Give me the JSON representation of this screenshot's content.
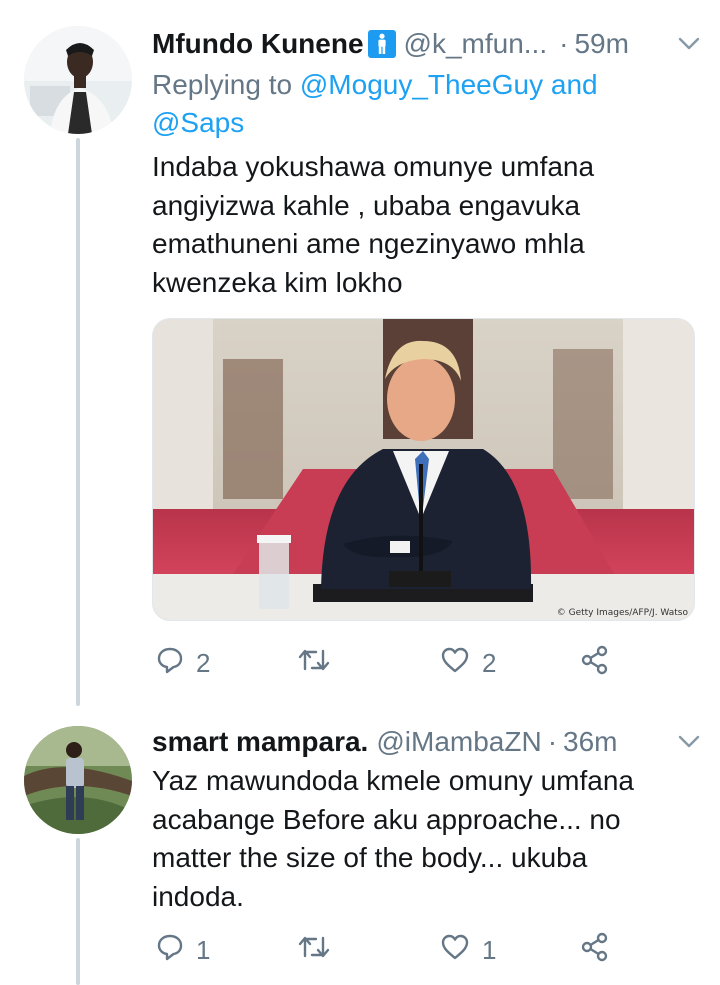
{
  "tweets": [
    {
      "display_name": "Mfundo Kunene",
      "handle": "@k_mfun...",
      "separator": "·",
      "time": "59m",
      "replying_label": "Replying to",
      "reply_mentions": [
        "@Moguy_TheeGuy",
        "@Saps"
      ],
      "reply_joiner": "and",
      "text_lines": [
        "Indaba yokushawa omunye umfana",
        "angiyizwa kahle , ubaba engavuka",
        "emathuneni ame ngezinyawo mhla",
        "kwenzeka kim lokho"
      ],
      "media_credit": "© Getty Images/AFP/J. Watso",
      "actions": {
        "replies": "2",
        "likes": "2"
      },
      "icons": {
        "badge": "man-emoji-icon",
        "menu": "chevron-down-icon"
      }
    },
    {
      "display_name": "smart mampara.",
      "handle": "@iMambaZN",
      "separator": "·",
      "time": "36m",
      "text_lines": [
        "Yaz mawundoda kmele omuny umfana",
        "acabange Before aku approache... no",
        "matter the size of the body... ukuba",
        "indoda."
      ],
      "actions": {
        "replies": "1",
        "likes": "1"
      },
      "icons": {
        "menu": "chevron-down-icon"
      }
    }
  ],
  "colors": {
    "link": "#1da1f2",
    "muted": "#657786",
    "thread_line": "#ccd6dd",
    "text": "#14171a"
  }
}
